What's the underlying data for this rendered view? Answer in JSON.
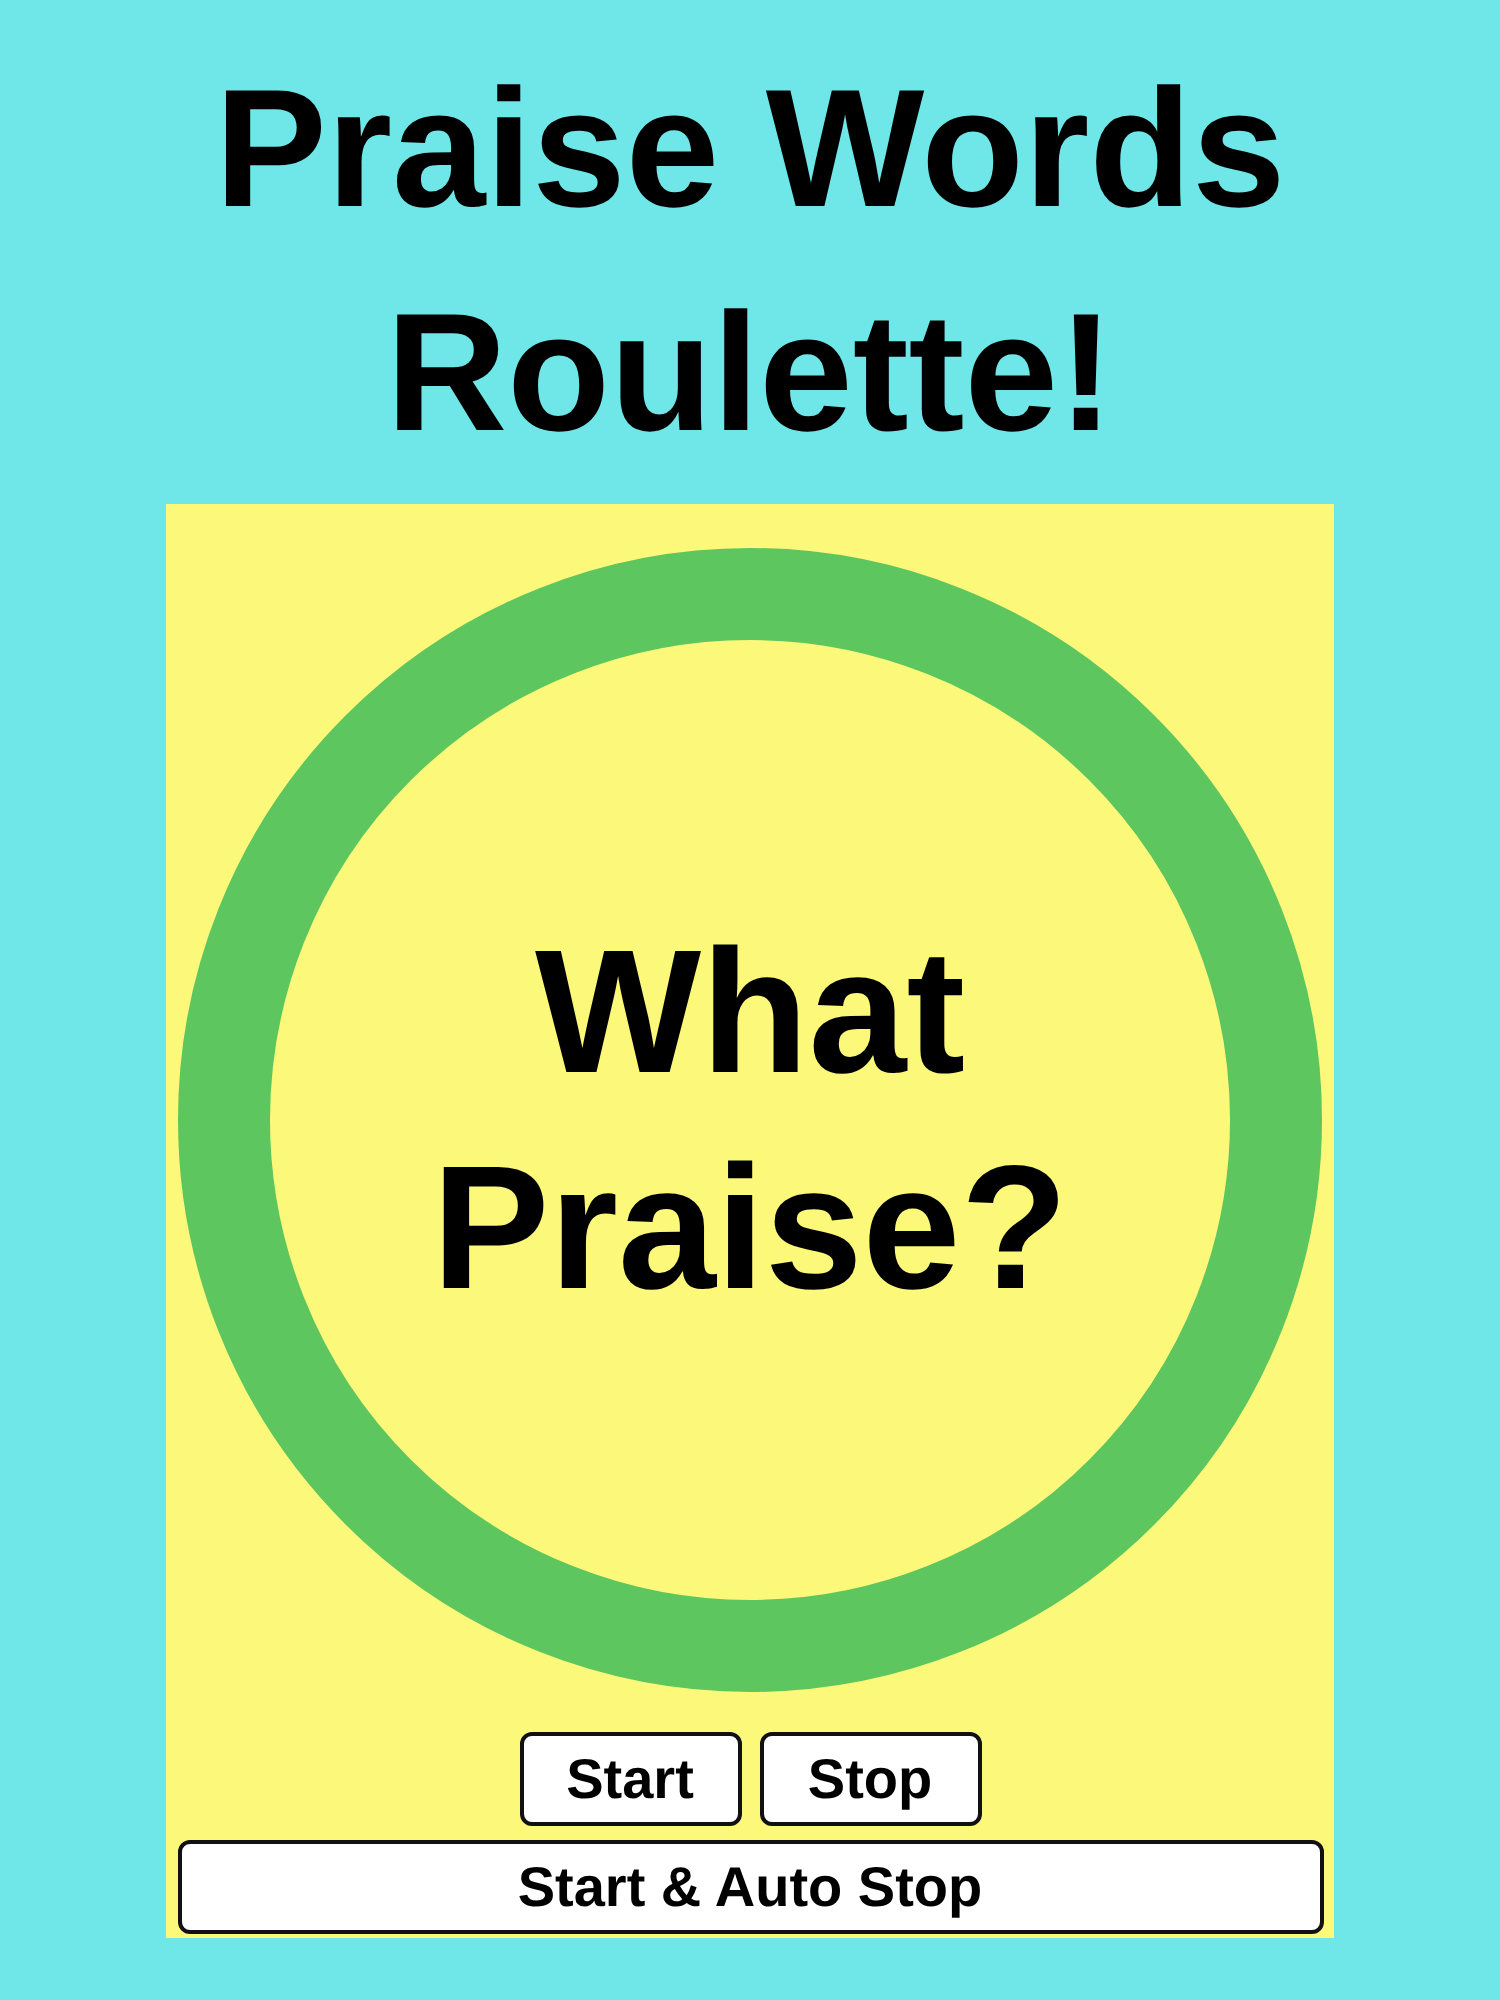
{
  "title": "Praise Words Roulette!",
  "roulette": {
    "text": "What Praise?"
  },
  "buttons": [
    {
      "label": "Start",
      "kind": "small"
    },
    {
      "label": "Stop",
      "kind": "small"
    },
    {
      "label": "Start & Auto Stop",
      "kind": "wide"
    }
  ]
}
